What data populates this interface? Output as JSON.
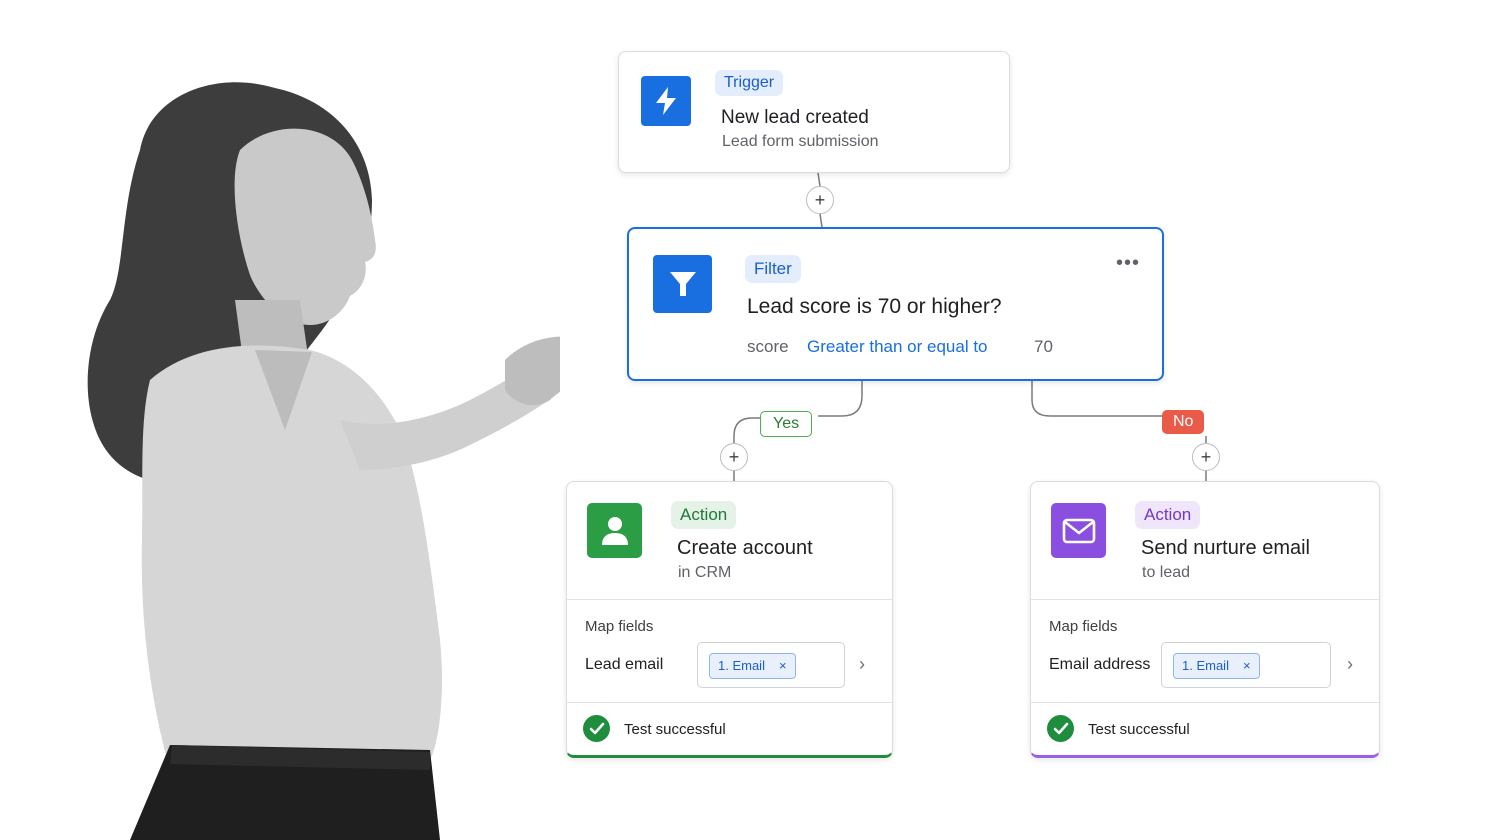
{
  "trigger": {
    "tag": "Trigger",
    "title": "New lead created",
    "subtitle": "Lead form submission",
    "icon": "bolt-icon"
  },
  "filter": {
    "tag": "Filter",
    "title": "Lead score is 70 or higher?",
    "more": "•••",
    "condition": {
      "field": "score",
      "operator": "Greater than or equal to",
      "value": "70"
    },
    "icon": "filter-icon"
  },
  "branches": {
    "yes_label": "Yes",
    "no_label": "No"
  },
  "add_step_symbol": "+",
  "actions": [
    {
      "tag": "Action",
      "title": "Create account",
      "subtitle": "in CRM",
      "icon": "person-icon",
      "map_label": "Map fields",
      "field_label": "Lead email",
      "chip": "1.  Email",
      "chip_remove": "×",
      "status": "Test successful",
      "accent": "#1e8e3e"
    },
    {
      "tag": "Action",
      "title": "Send nurture email",
      "subtitle": "to lead",
      "icon": "mail-icon",
      "map_label": "Map fields",
      "field_label": "Email address",
      "chip": "1.  Email",
      "chip_remove": "×",
      "status": "Test successful",
      "accent": "#9a5fe8"
    }
  ],
  "colors": {
    "primary": "#1a6fe0",
    "success": "#1e8e3e",
    "purple": "#8a4fe0",
    "no_branch": "#ea5a48"
  }
}
